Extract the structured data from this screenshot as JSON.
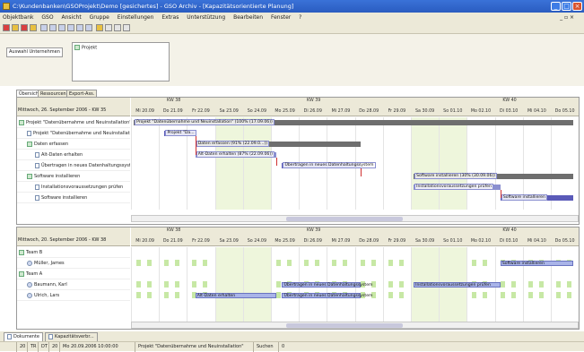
{
  "window": {
    "title": "C:\\Kundenbanken\\GSOProjekt\\Demo [gesichertes]  - GSO Archiv - [Kapazitätsorientierte Planung]",
    "minimize": "_",
    "maximize": "□",
    "close": "×"
  },
  "menu": [
    "Objektbank",
    "GSO",
    "Ansicht",
    "Gruppe",
    "Einstellungen",
    "Extras",
    "Unterstützung",
    "Bearbeiten",
    "Fenster",
    "?"
  ],
  "menu_right": "_ ▫ ×",
  "upper": {
    "button": "Auswahl Unternehmen",
    "project_label": "Projekt"
  },
  "tabs": [
    "Übersicht",
    "Ressourcen",
    "Export-Ass."
  ],
  "gantt": {
    "date_label": "Mittwoch, 26. September 2006 - KW 35",
    "weeks": [
      "KW 38",
      "KW 39",
      "KW 40"
    ],
    "days": [
      "Mi 20.09",
      "Do 21.09",
      "Fr 22.09",
      "Sa 23.09",
      "So 24.09",
      "Mo 25.09",
      "Di 26.09",
      "Mi 27.09",
      "Do 28.09",
      "Fr 29.09",
      "Sa 30.09",
      "So 01.10",
      "Mo 02.10",
      "Di 03.10",
      "Mi 04.10",
      "Do 05.10"
    ],
    "tree": [
      {
        "label": "Projekt \"Datenübernahme und Neuinstallation\"",
        "indent": 0,
        "icon": "project"
      },
      {
        "label": "Projekt \"Datenübernahme und Neuinstallation\"",
        "indent": 1,
        "icon": "doc"
      },
      {
        "label": "Daten erfassen",
        "indent": 1,
        "icon": "group"
      },
      {
        "label": "Alt-Daten erhalten",
        "indent": 2,
        "icon": "doc"
      },
      {
        "label": "Übertragen in neues Datenhaltungssystem",
        "indent": 2,
        "icon": "doc"
      },
      {
        "label": "Software installieren",
        "indent": 1,
        "icon": "group"
      },
      {
        "label": "Installationsvoraussetzungen prüfen",
        "indent": 2,
        "icon": "doc"
      },
      {
        "label": "Software installieren",
        "indent": 2,
        "icon": "doc"
      }
    ],
    "bars": [
      {
        "row": 0,
        "start": 0.1,
        "end": 15.8,
        "color": "#6e6e6e",
        "label": "Projekt \"Datenübernahme und Neuinstallation\" (100% (17.09.06))"
      },
      {
        "row": 1,
        "start": 1.2,
        "end": 2.3,
        "color": "#5a5ab8",
        "label": "Projekt \"Da..."
      },
      {
        "row": 2,
        "start": 2.3,
        "end": 8.2,
        "color": "#6e6e6e",
        "label": "Daten erfassen (91% (22.09.0...))"
      },
      {
        "row": 3,
        "start": 2.3,
        "end": 5.2,
        "color": "#8a8fd0",
        "label": "Alt-Daten erhalten (87% (22.09.06))"
      },
      {
        "row": 4,
        "start": 5.4,
        "end": 8.2,
        "color": "#5a5ab8",
        "label": "Übertragen in neues Datenhaltungssystem"
      },
      {
        "row": 5,
        "start": 10.1,
        "end": 15.8,
        "color": "#6e6e6e",
        "label": "Software installieren (30% (30.09.06))"
      },
      {
        "row": 6,
        "start": 10.1,
        "end": 13.2,
        "color": "#8a8fd0",
        "label": "Installationsvoraussetzungen prüfen"
      },
      {
        "row": 7,
        "start": 13.2,
        "end": 15.8,
        "color": "#5a5ab8",
        "label": "Software installieren"
      }
    ]
  },
  "resources": {
    "date_label": "Mittwoch, 20. September 2006 - KW 38",
    "weeks": [
      "KW 38",
      "KW 39",
      "KW 40"
    ],
    "days": [
      "Mi 20.09",
      "Do 21.09",
      "Fr 22.09",
      "Sa 23.09",
      "So 24.09",
      "Mo 25.09",
      "Di 26.09",
      "Mi 27.09",
      "Do 28.09",
      "Fr 29.09",
      "Sa 30.09",
      "So 01.10",
      "Mo 02.10",
      "Di 03.10",
      "Mi 04.10",
      "Do 05.10"
    ],
    "tree": [
      {
        "label": "Team B",
        "indent": 0,
        "icon": "group"
      },
      {
        "label": "Müller, James",
        "indent": 1,
        "icon": "person"
      },
      {
        "label": "Team A",
        "indent": 0,
        "icon": "group"
      },
      {
        "label": "Baumann, Karl",
        "indent": 1,
        "icon": "person"
      },
      {
        "label": "Ulrich, Lars",
        "indent": 1,
        "icon": "person"
      }
    ],
    "bars": [
      {
        "row": 1,
        "start": 13.2,
        "end": 15.8,
        "label": "Software installieren"
      },
      {
        "row": 3,
        "start": 5.4,
        "end": 8.2,
        "label": "Übertragen in neues Datenhaltungssystem"
      },
      {
        "row": 3,
        "start": 10.1,
        "end": 13.2,
        "label": "Installationsvoraussetzungen prüfen"
      },
      {
        "row": 4,
        "start": 2.3,
        "end": 5.2,
        "label": "Alt-Daten erhalten"
      },
      {
        "row": 4,
        "start": 5.4,
        "end": 8.2,
        "label": "Übertragen in neues Datenhaltungssystem"
      }
    ]
  },
  "bottom_tabs": [
    "Dokumente",
    "Kapazitätsverbr..."
  ],
  "status": [
    "20",
    "TR",
    "DT",
    "20",
    "Mo 20.09.2006 10:00:00",
    "Projekt \"Datenübernahme und Neuinstallation\"",
    "Suchen",
    "0"
  ],
  "colors": {
    "title_bar": "#2a5cc0",
    "chrome": "#ece9d8",
    "weekend": "#eef6dc",
    "capacity": "#c7e8a5",
    "res_bar": "#a9b4e8"
  }
}
